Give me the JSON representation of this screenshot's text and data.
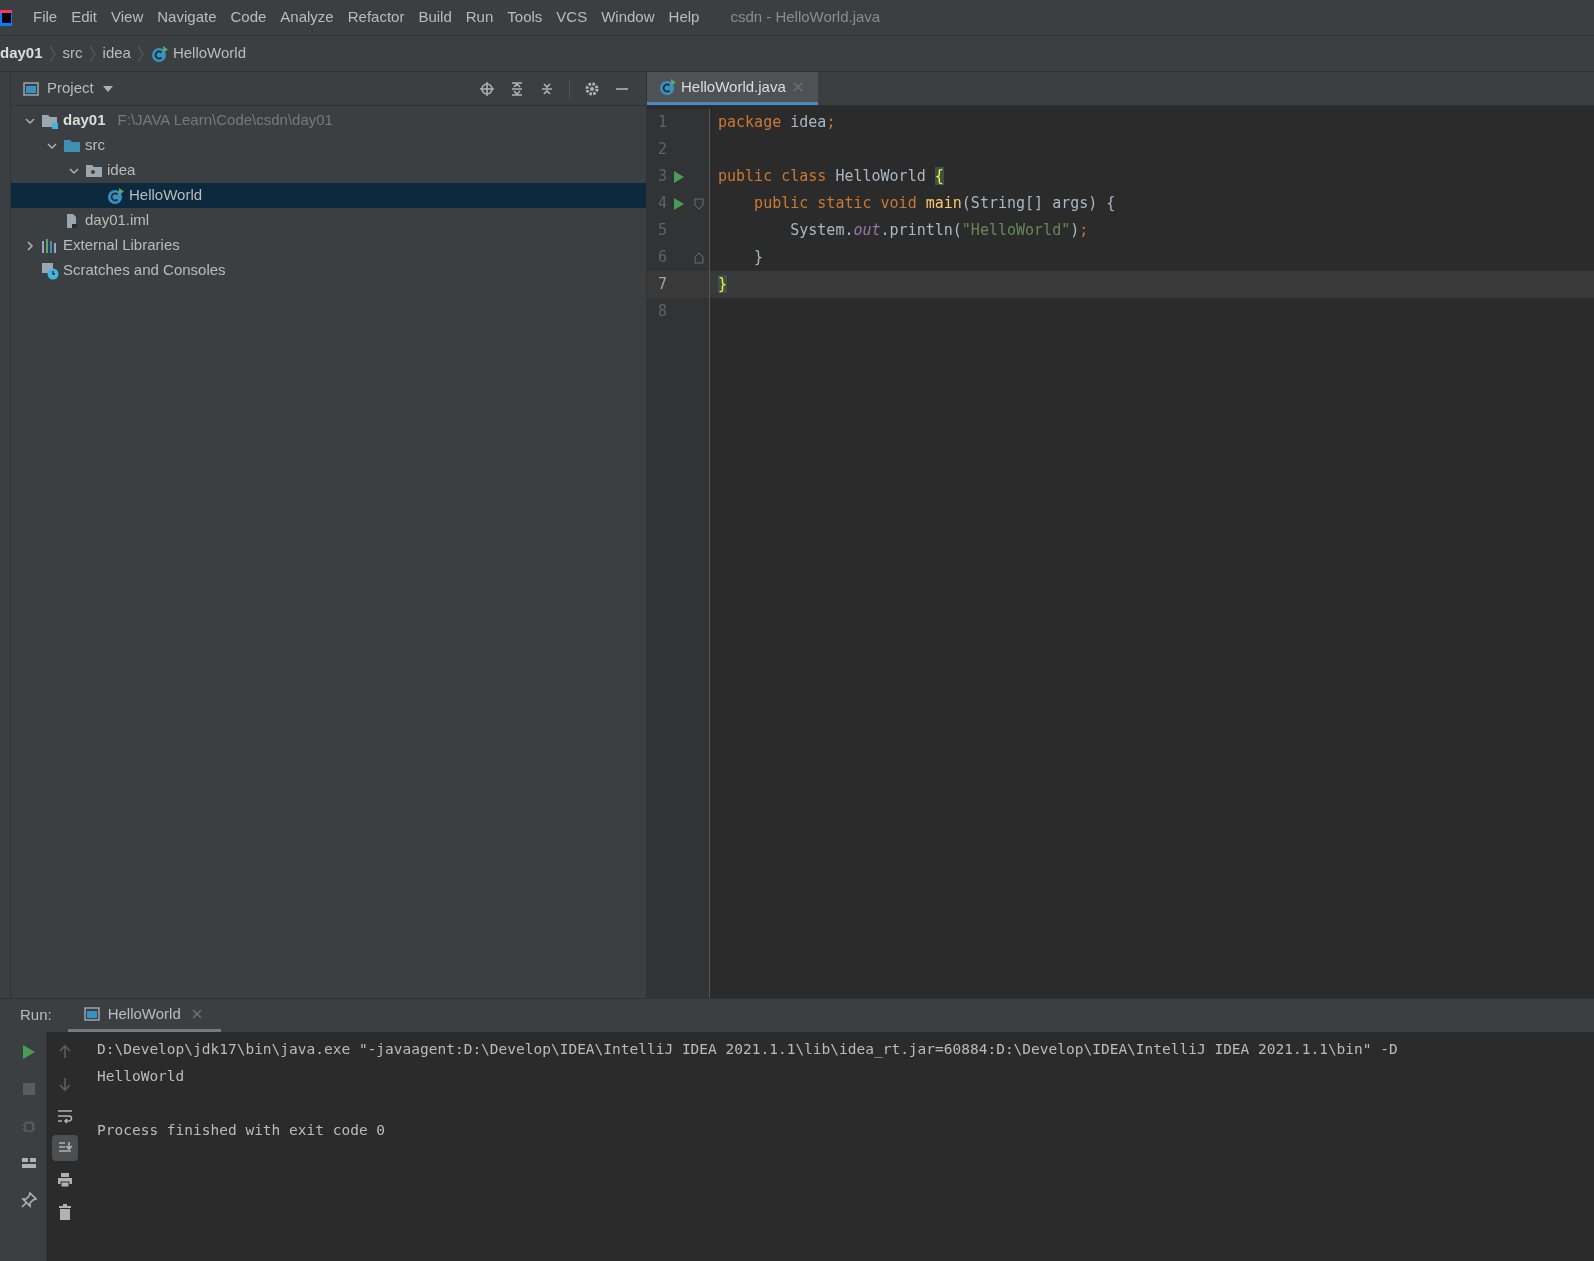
{
  "menu": [
    "File",
    "Edit",
    "View",
    "Navigate",
    "Code",
    "Analyze",
    "Refactor",
    "Build",
    "Run",
    "Tools",
    "VCS",
    "Window",
    "Help"
  ],
  "window": {
    "title": "csdn - HelloWorld.java"
  },
  "breadcrumbs": [
    {
      "label": "day01",
      "kind": "module"
    },
    {
      "label": "src",
      "kind": "folder"
    },
    {
      "label": "idea",
      "kind": "folder"
    },
    {
      "label": "HelloWorld",
      "kind": "class"
    }
  ],
  "project_panel": {
    "title": "Project",
    "tree": [
      {
        "label": "day01",
        "kind": "module",
        "path": "F:\\JAVA Learn\\Code\\csdn\\day01",
        "expanded": true,
        "selected": false,
        "children": [
          {
            "label": "src",
            "kind": "folder",
            "expanded": true,
            "selected": false,
            "children": [
              {
                "label": "idea",
                "kind": "package",
                "expanded": true,
                "selected": false,
                "children": [
                  {
                    "label": "HelloWorld",
                    "kind": "class",
                    "selected": true
                  }
                ]
              }
            ]
          },
          {
            "label": "day01.iml",
            "kind": "file",
            "selected": false
          }
        ]
      },
      {
        "label": "External Libraries",
        "kind": "libraries",
        "expanded": false,
        "selected": false
      },
      {
        "label": "Scratches and Consoles",
        "kind": "scratches",
        "selected": false
      }
    ]
  },
  "editor": {
    "tabs": [
      {
        "label": "HelloWorld.java",
        "selected": true
      }
    ],
    "lines": [
      {
        "number": "1",
        "tokens": [
          {
            "kind": "kw",
            "text": "package "
          },
          {
            "kind": "plain",
            "text": "idea"
          },
          {
            "kind": "kw",
            "text": ";"
          }
        ]
      },
      {
        "number": "2"
      },
      {
        "number": "3",
        "runnable": true,
        "tokens": [
          {
            "kind": "kw",
            "text": "public class "
          },
          {
            "kind": "plain",
            "text": "HelloWorld "
          },
          {
            "kind": "brace",
            "text": "{"
          }
        ]
      },
      {
        "number": "4",
        "runnable": true,
        "fold_start": true,
        "tokens": [
          {
            "kind": "kw",
            "text": "    public static void "
          },
          {
            "kind": "fn",
            "text": "main"
          },
          {
            "kind": "plain",
            "text": "(String[] args) {"
          }
        ]
      },
      {
        "number": "5",
        "tokens": [
          {
            "kind": "plain",
            "text": "        System."
          },
          {
            "kind": "field",
            "text": "out"
          },
          {
            "kind": "plain",
            "text": ".println("
          },
          {
            "kind": "str",
            "text": "\"HelloWorld\""
          },
          {
            "kind": "plain",
            "text": ")"
          },
          {
            "kind": "kw",
            "text": ";"
          }
        ]
      },
      {
        "number": "6",
        "fold_end": true,
        "tokens": [
          {
            "kind": "plain",
            "text": "    }"
          }
        ]
      },
      {
        "number": "7",
        "current": true,
        "tokens": [
          {
            "kind": "brace",
            "text": "}"
          }
        ]
      },
      {
        "number": "8"
      }
    ]
  },
  "run_panel": {
    "label": "Run:",
    "tabs": [
      {
        "label": "HelloWorld",
        "selected": true
      }
    ],
    "output": [
      {
        "kind": "command",
        "text": "D:\\Develop\\jdk17\\bin\\java.exe \"-javaagent:D:\\Develop\\IDEA\\IntelliJ IDEA 2021.1.1\\lib\\idea_rt.jar=60884:D:\\Develop\\IDEA\\IntelliJ IDEA 2021.1.1\\bin\" -D"
      },
      {
        "kind": "stdout",
        "text": "HelloWorld"
      },
      {
        "kind": "exit",
        "text": "Process finished with exit code 0"
      }
    ]
  }
}
